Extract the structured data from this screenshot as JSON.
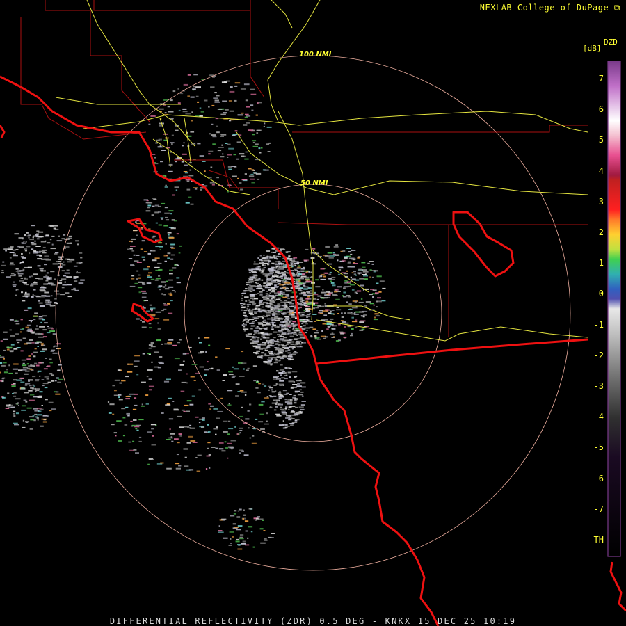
{
  "header": {
    "credit": "NEXLAB-College of DuPage"
  },
  "footer": {
    "product_line": "DIFFERENTIAL REFLECTIVITY (ZDR) 0.5 DEG - KNKX 15 DEC 25 10:19"
  },
  "radar": {
    "range_rings": [
      {
        "label": "50 NMI"
      },
      {
        "label": "100 NMI"
      }
    ]
  },
  "colorbar": {
    "product_code": "DZD",
    "unit": "[dB]",
    "ticks": [
      "7",
      "6",
      "5",
      "4",
      "3",
      "2",
      "1",
      "0",
      "-1",
      "-2",
      "-3",
      "-4",
      "-5",
      "-6",
      "-7",
      "TH"
    ]
  },
  "colors": {
    "coast_border": "#ee1111",
    "county_lines": "#aa1111",
    "highways": "#ffff33",
    "range_ring": "#f0b0a0",
    "label_text": "#ffff33"
  }
}
